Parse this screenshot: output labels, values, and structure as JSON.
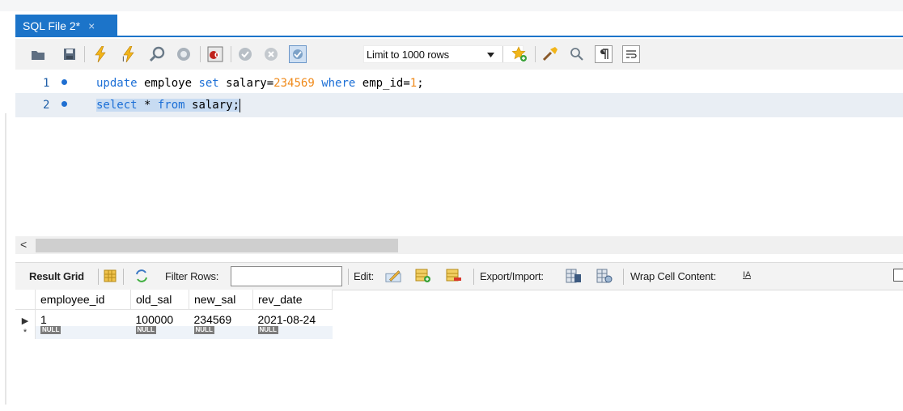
{
  "tab": {
    "title": "SQL File 2*",
    "close": "×"
  },
  "toolbar": {
    "limit_label": "Limit to 1000 rows",
    "icons": [
      "folder-open-icon",
      "save-icon",
      "execute-icon",
      "execute-current-icon",
      "explain-icon",
      "stop-icon",
      "toggle-result-icon",
      "commit-icon",
      "rollback-icon",
      "autocommit-icon",
      "bookmark-add-icon",
      "beautify-icon",
      "find-icon",
      "invisible-chars-icon",
      "wrap-icon"
    ]
  },
  "editor": {
    "lines": [
      {
        "num": "1",
        "kw1": "update",
        "t1": " employe ",
        "kw2": "set",
        "t2": " salary=",
        "num_val": "234569",
        "t3": " ",
        "kw3": "where",
        "t4": " emp_id=",
        "num2": "1",
        "t5": ";"
      },
      {
        "num": "2",
        "kw1": "select",
        "t1": " * ",
        "kw2": "from",
        "t2": " salary;"
      }
    ]
  },
  "scroll": {
    "left_arrow": "<"
  },
  "results": {
    "result_grid": "Result Grid",
    "filter_rows": "Filter Rows:",
    "edit": "Edit:",
    "export_import": "Export/Import:",
    "wrap_cell": "Wrap Cell Content:",
    "wrap_icon_text": "IA",
    "columns": [
      "employee_id",
      "old_sal",
      "new_sal",
      "rev_date"
    ],
    "row1": [
      "1",
      "100000",
      "234569",
      "2021-08-24"
    ],
    "null_label": "NULL",
    "row_arrow": "▶",
    "row_new": "*"
  },
  "colors": {
    "accent": "#1c74c9",
    "keyword": "#1c6fd6",
    "number": "#f08a1a"
  }
}
